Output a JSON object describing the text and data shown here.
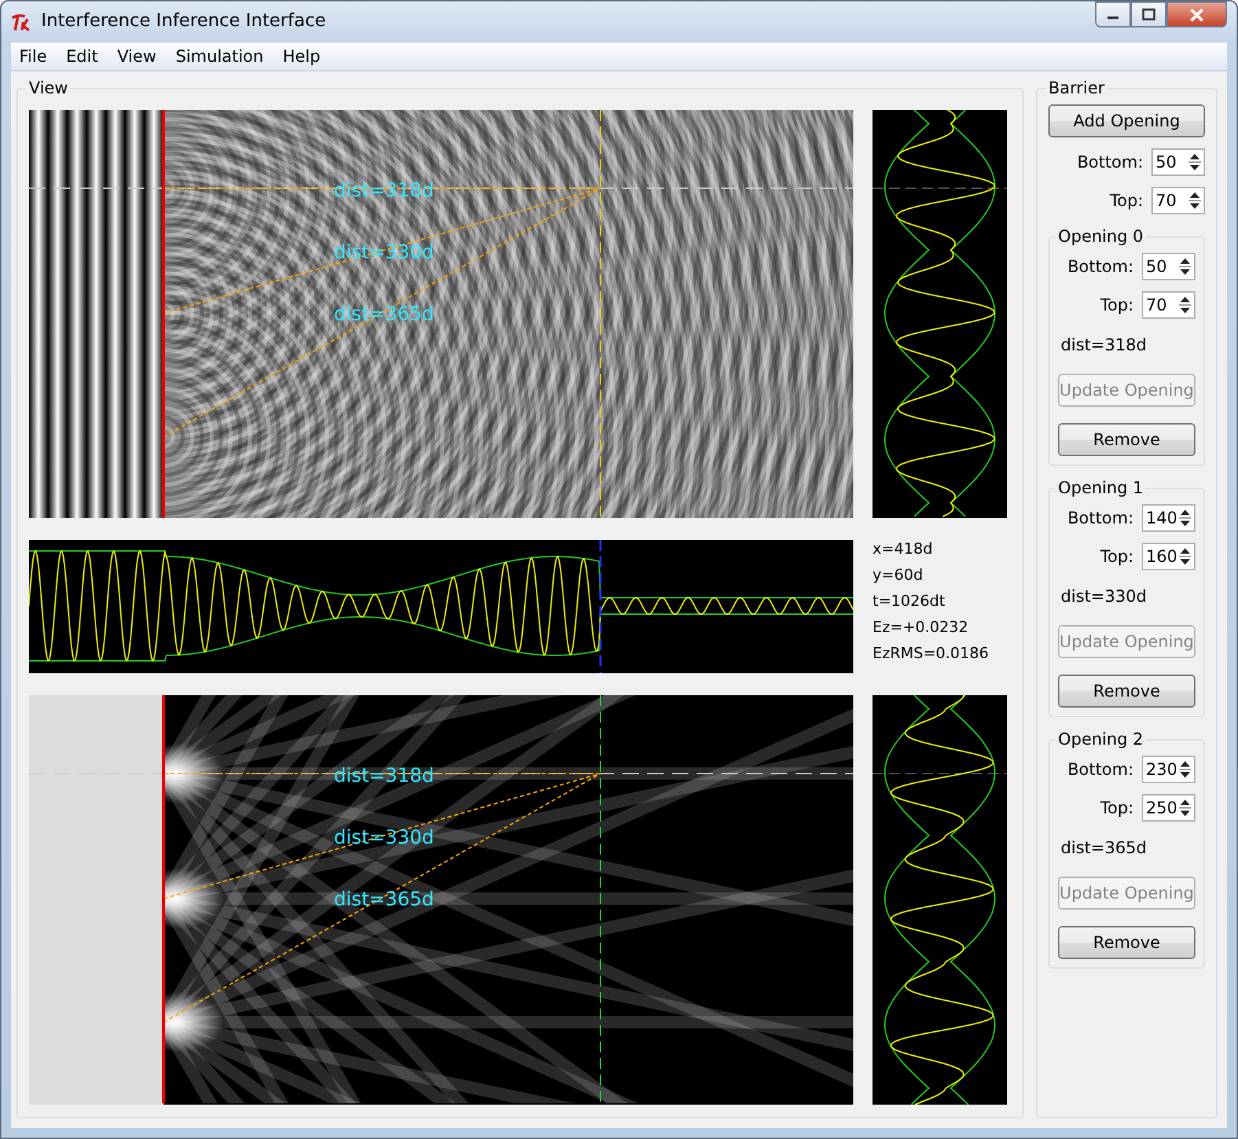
{
  "window": {
    "title": "Interference Inference Interface"
  },
  "menu": [
    "File",
    "Edit",
    "View",
    "Simulation",
    "Help"
  ],
  "view": {
    "label": "View",
    "field_panel": {
      "dist_labels": [
        "dist=318d",
        "dist=330d",
        "dist=365d"
      ]
    },
    "intensity_panel": {
      "dist_labels": [
        "dist=318d",
        "dist=330d",
        "dist=365d"
      ]
    },
    "readings": [
      "x=418d",
      "y=60d",
      "t=1026dt",
      "Ez=+0.0232",
      "EzRMS=0.0186"
    ]
  },
  "barrier": {
    "label": "Barrier",
    "add_button": "Add Opening",
    "bottom": {
      "label": "Bottom:",
      "value": "50"
    },
    "top": {
      "label": "Top:",
      "value": "70"
    },
    "openings": [
      {
        "label": "Opening 0",
        "bottom": {
          "label": "Bottom:",
          "value": "50"
        },
        "top": {
          "label": "Top:",
          "value": "70"
        },
        "dist": "dist=318d",
        "update_button": {
          "label": "Update Opening",
          "disabled": true
        },
        "remove_button": "Remove"
      },
      {
        "label": "Opening 1",
        "bottom": {
          "label": "Bottom:",
          "value": "140"
        },
        "top": {
          "label": "Top:",
          "value": "160"
        },
        "dist": "dist=330d",
        "update_button": {
          "label": "Update Opening",
          "disabled": true
        },
        "remove_button": "Remove"
      },
      {
        "label": "Opening 2",
        "bottom": {
          "label": "Bottom:",
          "value": "230"
        },
        "top": {
          "label": "Top:",
          "value": "250"
        },
        "dist": "dist=365d",
        "update_button": {
          "label": "Update Opening",
          "disabled": true
        },
        "remove_button": "Remove"
      }
    ]
  }
}
